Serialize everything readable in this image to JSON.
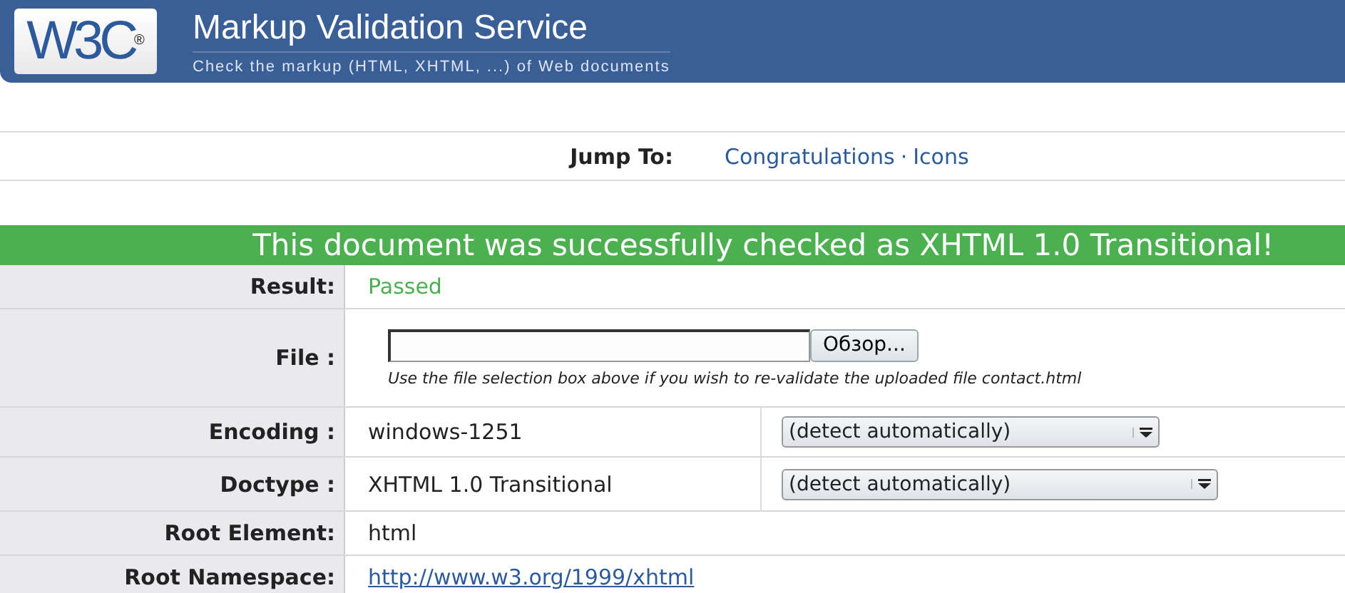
{
  "header": {
    "logo": "W3C$^{®}$",
    "title": "Markup Validation Service",
    "subtitle": "Check the markup (HTML, XHTML, ...) of Web documents"
  },
  "jump": {
    "label": "Jump To:",
    "separator": "·",
    "links": [
      {
        "text": "Congratulations"
      },
      {
        "text": "Icons"
      }
    ]
  },
  "banner": "This document was successfully checked as XHTML 1.0 Transitional!",
  "rows": [
    {
      "kind": "text",
      "label": "Result:",
      "value": "Passed",
      "passed": true
    },
    {
      "kind": "file",
      "label": "File :",
      "button": "Обзор...",
      "note": "Use the file selection box above if you wish to re-validate the uploaded file contact.html"
    },
    {
      "kind": "select",
      "label": "Encoding :",
      "value": "windows-1251",
      "select": "(detect automatically)"
    },
    {
      "kind": "select",
      "label": "Doctype :",
      "value": "XHTML 1.0 Transitional",
      "select": "(detect automatically)"
    },
    {
      "kind": "text",
      "label": "Root Element:",
      "value": "html",
      "passed": false
    },
    {
      "kind": "link",
      "label": "Root Namespace:",
      "value": "http://www.w3.org/1999/xhtml"
    }
  ]
}
